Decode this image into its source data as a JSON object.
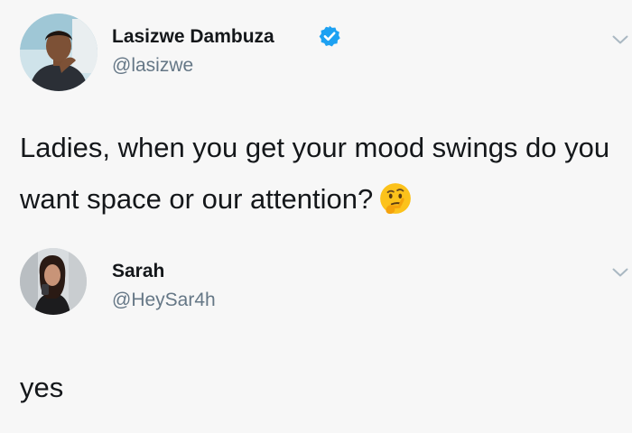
{
  "tweets": [
    {
      "display_name": "Lasizwe Dambuza",
      "handle": "@lasizwe",
      "verified": true,
      "text": "Ladies, when you get your mood swings do you want space or our attention?",
      "trailing_emoji": "thinking-face-icon"
    },
    {
      "display_name": "Sarah",
      "handle": "@HeySar4h",
      "verified": false,
      "text": "yes"
    }
  ],
  "colors": {
    "background": "#f7f7f7",
    "text": "#14171a",
    "handle": "#657786",
    "verified_badge": "#1da1f2",
    "chevron": "#aab8c2"
  }
}
